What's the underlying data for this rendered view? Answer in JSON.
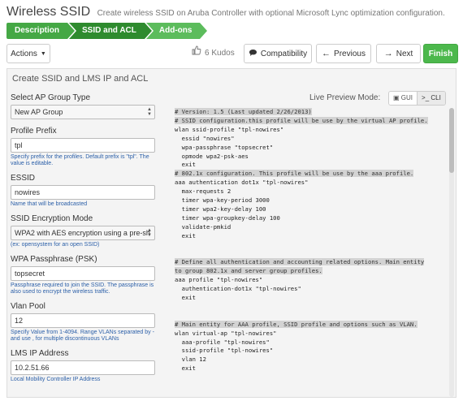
{
  "header": {
    "title": "Wireless SSID",
    "subtitle": "Create wireless SSID on Aruba Controller with optional Microsoft Lync optimization configuration."
  },
  "steps": [
    "Description",
    "SSID and ACL",
    "Add-ons"
  ],
  "toolbar": {
    "actions_label": "Actions",
    "kudos_label": "6 Kudos",
    "compatibility_label": "Compatibility",
    "previous_label": "Previous",
    "next_label": "Next",
    "finish_label": "Finish"
  },
  "panel": {
    "title": "Create SSID and LMS IP and ACL",
    "preview_mode_label": "Live Preview Mode:",
    "gui_label": "GUI",
    "cli_label": ">_ CLI"
  },
  "form": {
    "ap_group": {
      "label": "Select AP Group Type",
      "value": "New AP Group"
    },
    "profile_prefix": {
      "label": "Profile Prefix",
      "value": "tpl",
      "help": "Specify prefix for the profiles. Default prefix is \"tpl\". The value is editable."
    },
    "essid": {
      "label": "ESSID",
      "value": "nowires",
      "help": "Name that will be broadcasted"
    },
    "encryption": {
      "label": "SSID Encryption Mode",
      "value": "WPA2 with AES encryption using a pre-sh",
      "help": "(ex: opensystem for an open SSID)"
    },
    "passphrase": {
      "label": "WPA Passphrase (PSK)",
      "value": "topsecret",
      "help": "Passphrase required to join the SSID. The passphrase is also used to encrypt the wireless traffic."
    },
    "vlan_pool": {
      "label": "Vlan Pool",
      "value": "12",
      "help": "Specify Value from 1-4094. Range VLANs separated by - and use , for multiple discontinuous VLANs"
    },
    "lms_ip": {
      "label": "LMS IP Address",
      "value": "10.2.51.66",
      "help": "Local Mobility Controller IP Address"
    }
  },
  "code_lines": [
    {
      "text": "# Version: 1.5 (Last updated 2/26/2013)",
      "comment": true
    },
    {
      "text": "# SSID configuration.this profile will be use by the virtual AP profile.",
      "comment": true
    },
    {
      "text": "wlan ssid-profile \"tpl-nowires\"",
      "comment": false
    },
    {
      "text": "  essid \"nowires\"",
      "comment": false
    },
    {
      "text": "  wpa-passphrase \"topsecret\"",
      "comment": false
    },
    {
      "text": "  opmode wpa2-psk-aes",
      "comment": false
    },
    {
      "text": "  exit",
      "comment": false
    },
    {
      "text": "# 802.1x configuration. This profile will be use by the aaa profile.",
      "comment": true
    },
    {
      "text": "aaa authentication dot1x \"tpl-nowires\"",
      "comment": false
    },
    {
      "text": "  max-requests 2",
      "comment": false
    },
    {
      "text": "  timer wpa-key-period 3000",
      "comment": false
    },
    {
      "text": "  timer wpa2-key-delay 100",
      "comment": false
    },
    {
      "text": "  timer wpa-groupkey-delay 100",
      "comment": false
    },
    {
      "text": "  validate-pmkid",
      "comment": false
    },
    {
      "text": "  exit",
      "comment": false
    },
    {
      "text": "",
      "comment": false
    },
    {
      "text": "",
      "comment": false
    },
    {
      "text": "# Define all authentication and accounting related options. Main entity",
      "comment": true
    },
    {
      "text": "to group 802.1x and server group profiles.",
      "comment": true
    },
    {
      "text": "aaa profile \"tpl-nowires\"",
      "comment": false
    },
    {
      "text": "  authentication-dot1x \"tpl-nowires\"",
      "comment": false
    },
    {
      "text": "  exit",
      "comment": false
    },
    {
      "text": "",
      "comment": false
    },
    {
      "text": "",
      "comment": false
    },
    {
      "text": "# Main entity for AAA profile, SSID profile and options such as VLAN.",
      "comment": true
    },
    {
      "text": "wlan virtual-ap \"tpl-nowires\"",
      "comment": false
    },
    {
      "text": "  aaa-profile \"tpl-nowires\"",
      "comment": false
    },
    {
      "text": "  ssid-profile \"tpl-nowires\"",
      "comment": false
    },
    {
      "text": "  vlan 12",
      "comment": false
    },
    {
      "text": "  exit",
      "comment": false
    }
  ]
}
